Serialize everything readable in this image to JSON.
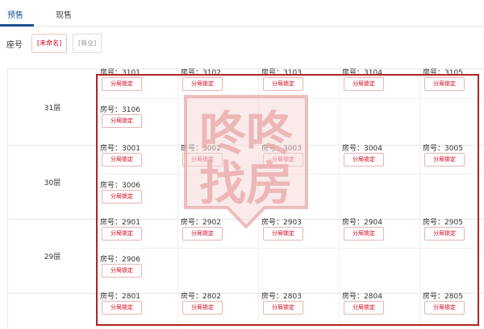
{
  "tabs": [
    {
      "label": "预售"
    },
    {
      "label": "现售"
    }
  ],
  "seat": {
    "label": "座号",
    "options": [
      {
        "label": "[未命名]"
      },
      {
        "label": "[商业]"
      }
    ]
  },
  "floors": [
    {
      "label": "31层",
      "rows": [
        [
          "3101",
          "3102",
          "3103",
          "3104",
          "3105"
        ],
        [
          "3106"
        ]
      ]
    },
    {
      "label": "30层",
      "rows": [
        [
          "3001",
          "3002",
          "3003",
          "3004",
          "3005"
        ],
        [
          "3006"
        ]
      ]
    },
    {
      "label": "29层",
      "rows": [
        [
          "2901",
          "2902",
          "2903",
          "2904",
          "2905"
        ],
        [
          "2906"
        ]
      ]
    },
    {
      "label": "",
      "rows": [
        [
          "2801",
          "2802",
          "2803",
          "2804",
          "2805"
        ]
      ]
    }
  ],
  "room_prefix": "房号：",
  "lock_label": "分局锁定",
  "watermark": {
    "text": "咚咚找房",
    "color": "#e8a5a5"
  },
  "colors": {
    "accent": "#1d4f91",
    "highlight": "#b22222",
    "lock": "#d0011b"
  }
}
